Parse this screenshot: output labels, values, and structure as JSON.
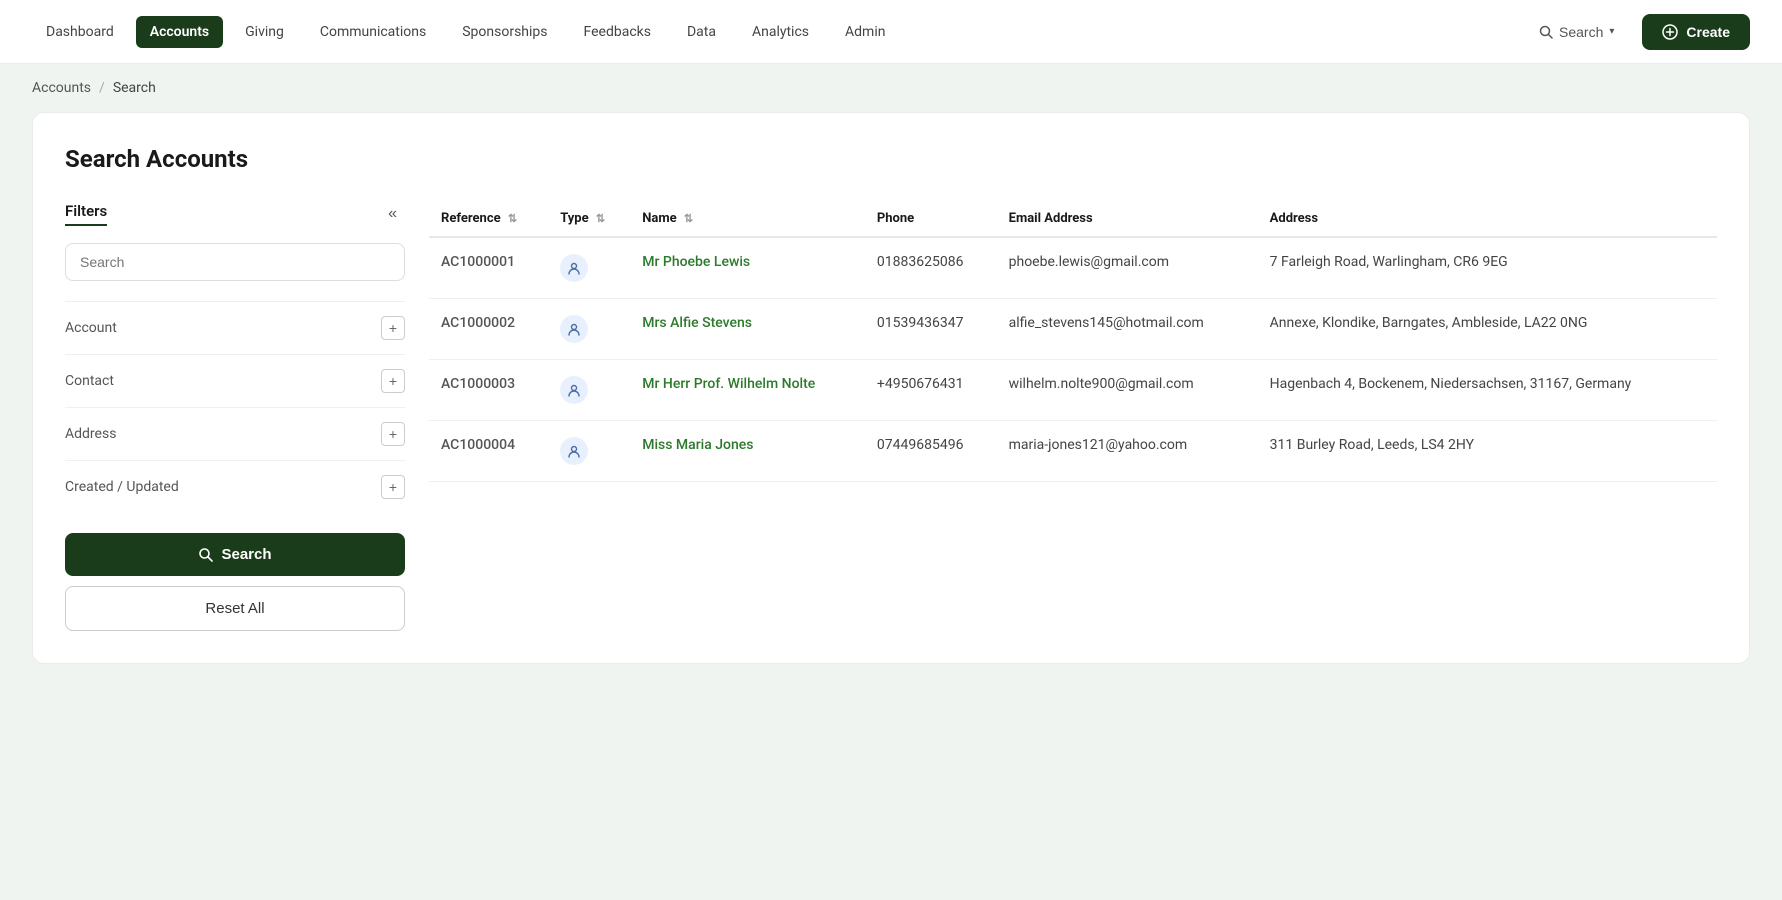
{
  "navbar": {
    "links": [
      {
        "label": "Dashboard",
        "active": false
      },
      {
        "label": "Accounts",
        "active": true
      },
      {
        "label": "Giving",
        "active": false
      },
      {
        "label": "Communications",
        "active": false
      },
      {
        "label": "Sponsorships",
        "active": false
      },
      {
        "label": "Feedbacks",
        "active": false
      },
      {
        "label": "Data",
        "active": false
      },
      {
        "label": "Analytics",
        "active": false
      },
      {
        "label": "Admin",
        "active": false
      }
    ],
    "search_label": "Search",
    "create_label": "Create"
  },
  "breadcrumb": {
    "root": "Accounts",
    "separator": "/",
    "current": "Search"
  },
  "page": {
    "title": "Search Accounts"
  },
  "filters": {
    "title": "Filters",
    "search_placeholder": "Search",
    "sections": [
      {
        "label": "Account"
      },
      {
        "label": "Contact"
      },
      {
        "label": "Address"
      },
      {
        "label": "Created / Updated"
      }
    ],
    "search_btn": "Search",
    "reset_btn": "Reset All"
  },
  "table": {
    "columns": [
      {
        "label": "Reference",
        "sortable": true
      },
      {
        "label": "Type",
        "sortable": true
      },
      {
        "label": "Name",
        "sortable": true
      },
      {
        "label": "Phone",
        "sortable": false
      },
      {
        "label": "Email Address",
        "sortable": false
      },
      {
        "label": "Address",
        "sortable": false
      }
    ],
    "rows": [
      {
        "reference": "AC1000001",
        "type": "person",
        "name": "Mr Phoebe Lewis",
        "phone": "01883625086",
        "email": "phoebe.lewis@gmail.com",
        "address": "7 Farleigh Road, Warlingham, CR6 9EG"
      },
      {
        "reference": "AC1000002",
        "type": "person",
        "name": "Mrs Alfie Stevens",
        "phone": "01539436347",
        "email": "alfie_stevens145@hotmail.com",
        "address": "Annexe, Klondike, Barngates, Ambleside, LA22 0NG"
      },
      {
        "reference": "AC1000003",
        "type": "person",
        "name": "Mr Herr Prof. Wilhelm Nolte",
        "phone": "+4950676431",
        "email": "wilhelm.nolte900@gmail.com",
        "address": "Hagenbach 4, Bockenem, Niedersachsen, 31167, Germany"
      },
      {
        "reference": "AC1000004",
        "type": "person",
        "name": "Miss Maria Jones",
        "phone": "07449685496",
        "email": "maria-jones121@yahoo.com",
        "address": "311 Burley Road, Leeds, LS4 2HY"
      }
    ]
  }
}
